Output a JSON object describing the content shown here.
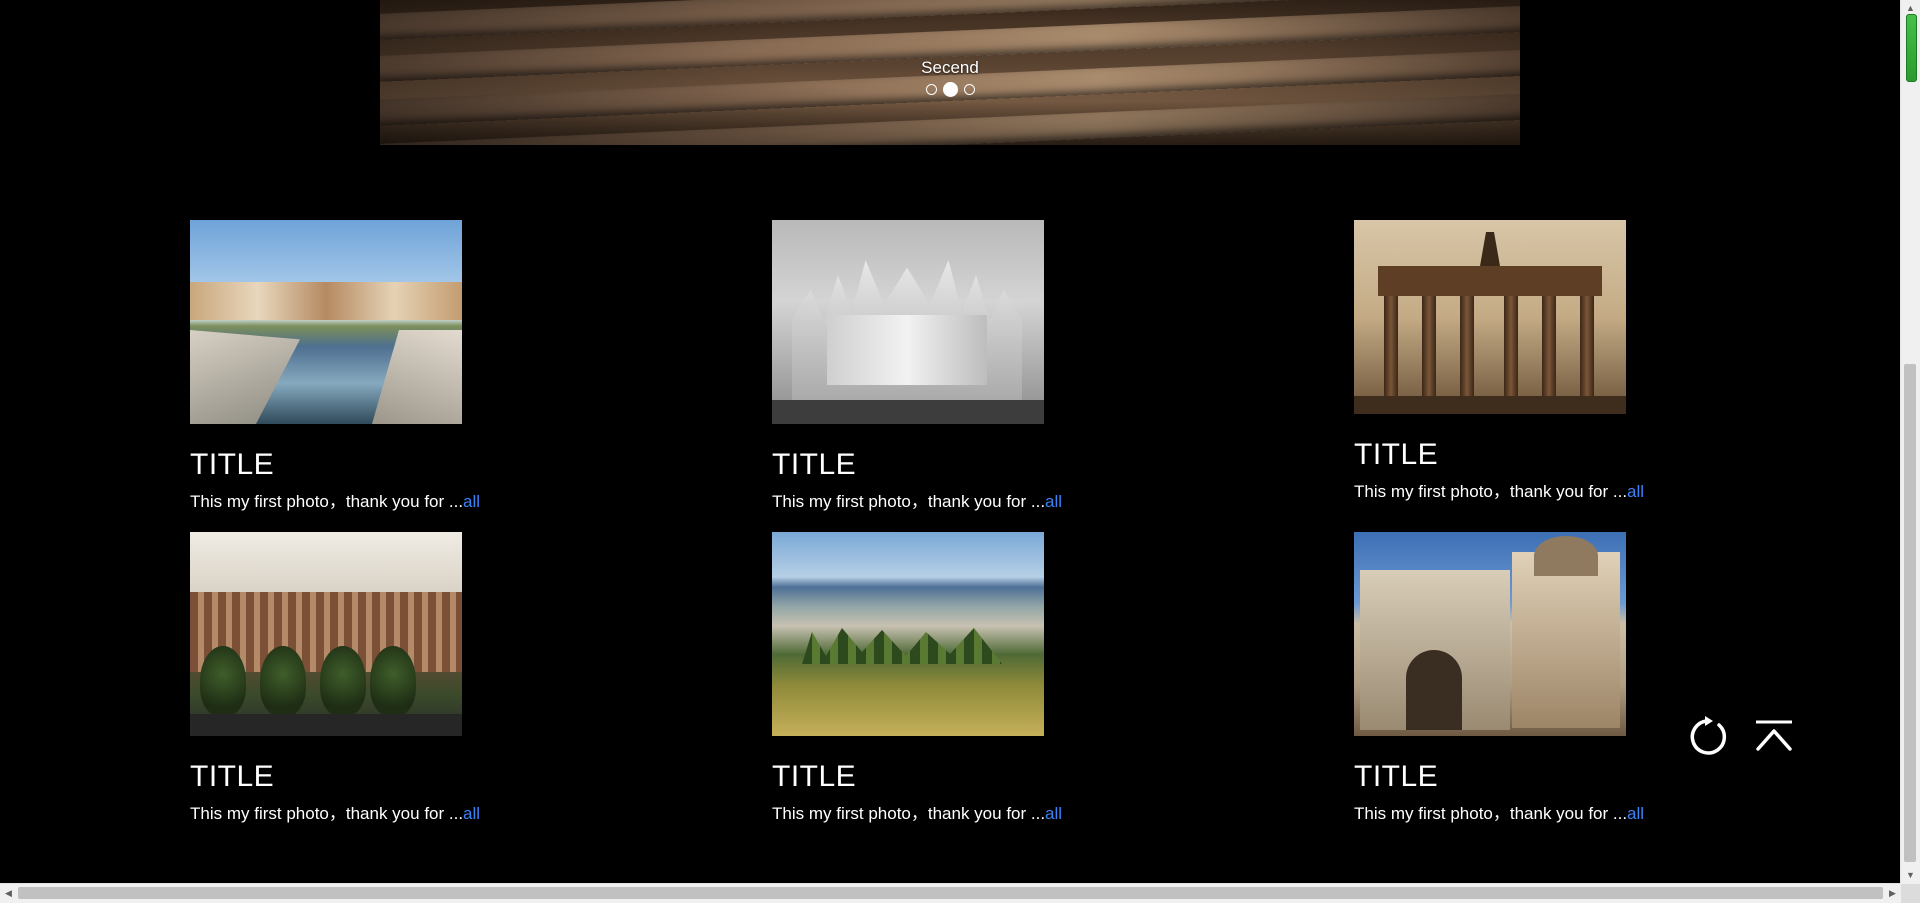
{
  "carousel": {
    "caption": "Secend",
    "dots": [
      "inactive",
      "active",
      "inactive"
    ]
  },
  "cards": [
    {
      "title": "TITLE",
      "desc": "This my first photo，thank you for ...",
      "more": "all",
      "image": "canal-photo"
    },
    {
      "title": "TITLE",
      "desc": "This my first photo，thank you for ...",
      "more": "all",
      "image": "cathedral-photo"
    },
    {
      "title": "TITLE",
      "desc": "This my first photo，thank you for ...",
      "more": "all",
      "image": "gate-photo"
    },
    {
      "title": "TITLE",
      "desc": "This my first photo，thank you for ...",
      "more": "all",
      "image": "museum-photo"
    },
    {
      "title": "TITLE",
      "desc": "This my first photo，thank you for ...",
      "more": "all",
      "image": "valley-photo"
    },
    {
      "title": "TITLE",
      "desc": "This my first photo，thank you for ...",
      "more": "all",
      "image": "arch-photo"
    }
  ],
  "controls": {
    "refresh_icon": "refresh-icon",
    "back_to_top_icon": "back-to-top-icon"
  },
  "colors": {
    "background": "#000000",
    "link": "#3b82f6",
    "text": "#ffffff"
  }
}
